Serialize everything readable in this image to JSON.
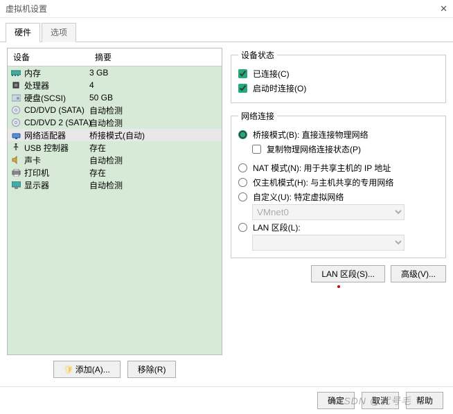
{
  "window": {
    "title": "虚拟机设置"
  },
  "tabs": {
    "hardware": "硬件",
    "options": "选项"
  },
  "table": {
    "col_device": "设备",
    "col_summary": "摘要",
    "rows": [
      {
        "icon": "memory",
        "name": "内存",
        "summary": "3 GB"
      },
      {
        "icon": "cpu",
        "name": "处理器",
        "summary": "4"
      },
      {
        "icon": "disk",
        "name": "硬盘(SCSI)",
        "summary": "50 GB"
      },
      {
        "icon": "cd",
        "name": "CD/DVD (SATA)",
        "summary": "自动检测"
      },
      {
        "icon": "cd",
        "name": "CD/DVD 2 (SATA)",
        "summary": "自动检测"
      },
      {
        "icon": "net",
        "name": "网络适配器",
        "summary": "桥接模式(自动)",
        "selected": true
      },
      {
        "icon": "usb",
        "name": "USB 控制器",
        "summary": "存在"
      },
      {
        "icon": "sound",
        "name": "声卡",
        "summary": "自动检测"
      },
      {
        "icon": "printer",
        "name": "打印机",
        "summary": "存在"
      },
      {
        "icon": "display",
        "name": "显示器",
        "summary": "自动检测"
      }
    ]
  },
  "left_buttons": {
    "add": "添加(A)...",
    "remove": "移除(R)"
  },
  "status_box": {
    "legend": "设备状态",
    "connected": "已连接(C)",
    "connect_at_power": "启动时连接(O)"
  },
  "net_box": {
    "legend": "网络连接",
    "bridged": "桥接模式(B): 直接连接物理网络",
    "replicate": "复制物理网络连接状态(P)",
    "nat": "NAT 模式(N): 用于共享主机的 IP 地址",
    "hostonly": "仅主机模式(H): 与主机共享的专用网络",
    "custom": "自定义(U): 特定虚拟网络",
    "custom_sel": "VMnet0",
    "lan": "LAN 区段(L):",
    "lan_sel": ""
  },
  "right_buttons": {
    "lan": "LAN 区段(S)...",
    "adv": "高级(V)..."
  },
  "footer": {
    "ok": "确定",
    "cancel": "取消",
    "help": "帮助"
  },
  "watermark": "CSDN @代号毛"
}
